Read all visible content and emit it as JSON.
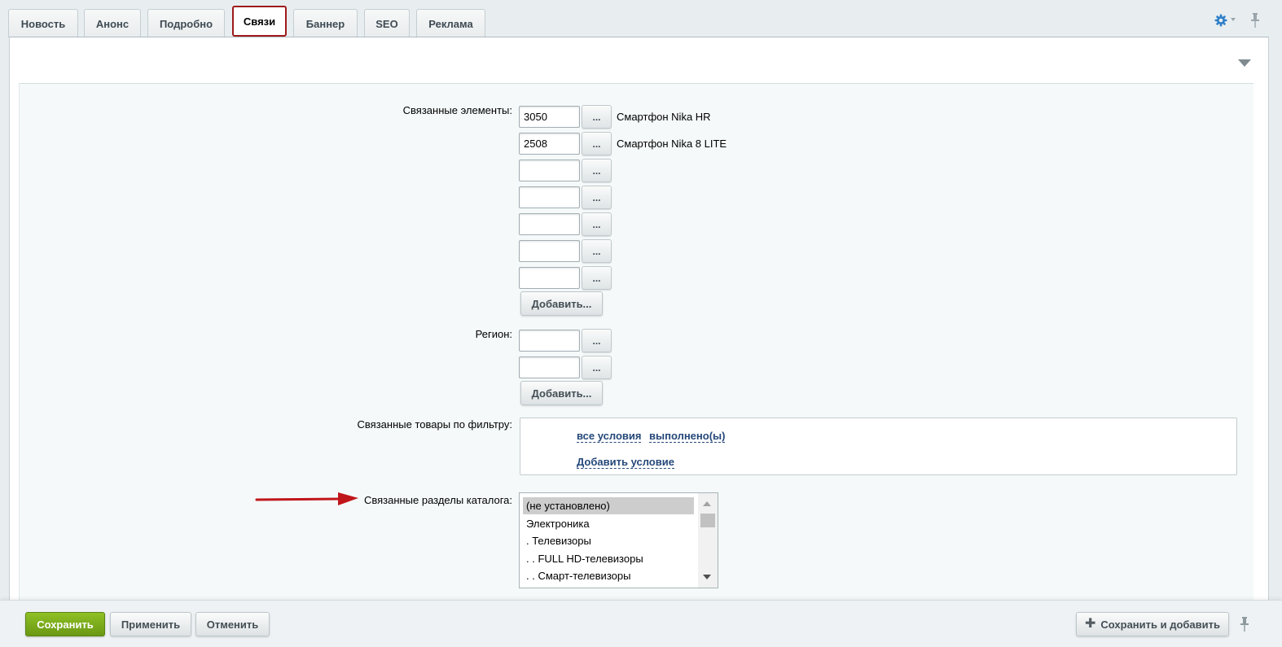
{
  "tabs": [
    {
      "label": "Новость"
    },
    {
      "label": "Анонс"
    },
    {
      "label": "Подробно"
    },
    {
      "label": "Связи",
      "active": true
    },
    {
      "label": "Баннер"
    },
    {
      "label": "SEO"
    },
    {
      "label": "Реклама"
    }
  ],
  "form": {
    "linked_elements": {
      "label": "Связанные элементы:",
      "rows": [
        {
          "value": "3050",
          "name": "Смартфон Nika HR"
        },
        {
          "value": "2508",
          "name": "Смартфон Nika 8 LITE"
        },
        {
          "value": "",
          "name": ""
        },
        {
          "value": "",
          "name": ""
        },
        {
          "value": "",
          "name": ""
        },
        {
          "value": "",
          "name": ""
        },
        {
          "value": "",
          "name": ""
        }
      ],
      "browse_label": "...",
      "add_label": "Добавить..."
    },
    "region": {
      "label": "Регион:",
      "rows": [
        {
          "value": ""
        },
        {
          "value": ""
        }
      ],
      "browse_label": "...",
      "add_label": "Добавить..."
    },
    "filter": {
      "label": "Связанные товары по фильтру:",
      "condition_all": "все условия",
      "condition_done": "выполнено(ы)",
      "add_condition": "Добавить условие"
    },
    "sections": {
      "label": "Связанные разделы каталога:",
      "options": [
        "(не установлено)",
        "Электроника",
        ". Телевизоры",
        ". . FULL HD-телевизоры",
        ". . Смарт-телевизоры"
      ],
      "selected": "(не установлено)"
    }
  },
  "footer": {
    "save": "Сохранить",
    "apply": "Применить",
    "cancel": "Отменить",
    "save_and_add": "Сохранить и добавить"
  },
  "colors": {
    "active_tab_border": "#9e1a1a",
    "save_button": "#7aab1b",
    "link": "#254879",
    "arrow": "#c0161b",
    "gear": "#2f7fc8"
  },
  "icons": [
    "gear-icon",
    "pin-icon",
    "collapse-triangle-icon",
    "plus-icon",
    "red-arrow-annotation"
  ]
}
